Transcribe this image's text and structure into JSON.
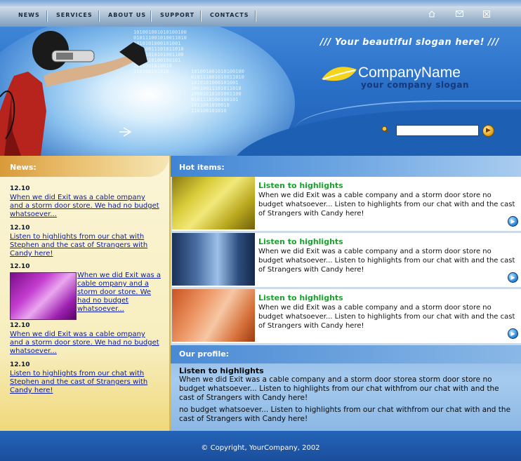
{
  "nav": {
    "items": [
      "NEWS",
      "SERVICES",
      "ABOUT US",
      "SUPPORT",
      "CONTACTS"
    ],
    "icons": [
      "home-icon",
      "mail-icon",
      "sitemap-icon"
    ]
  },
  "header": {
    "slogan": "///  Your beautiful slogan here!  ///",
    "company_name": "CompanyName",
    "company_slogan": "your company slogan",
    "binary_text": "101001001010100100\n010111001010011010\n1010101000101001\n10010011101011010\n10001010101001100\n0101110100100101\n1011001010010\n110100101010"
  },
  "search": {
    "placeholder": ""
  },
  "news": {
    "title": "News:",
    "items": [
      {
        "date": "12.10",
        "text": "When we did Exit was a cable ompany and a storm door store. We had no budget whatsoever..."
      },
      {
        "date": "12.10",
        "text": "Listen to highlights from our chat with Stephen and the cast of Strangers with Candy here!"
      },
      {
        "date": "12.10",
        "text": "When we did Exit was a cable ompany and a storm door store. We had no budget whatsoever..."
      },
      {
        "date": "12.10",
        "text": "When we did Exit was a cable ompany and a storm door store. We had no budget whatsoever..."
      },
      {
        "date": "12.10",
        "text": "Listen to highlights from our chat with Stephen and the cast of Strangers with Candy here!"
      }
    ]
  },
  "hot": {
    "title": "Hot items:",
    "items": [
      {
        "title": "Listen to highlights",
        "text": "When we did Exit was a cable company and a storm door store no budget whatsoever... Listen to highlights from our chat with and the cast of Strangers with Candy here!"
      },
      {
        "title": "Listen to highlights",
        "text": "When we did Exit was a cable company and a storm door store no budget whatsoever... Listen to highlights from our chat with and the cast of Strangers with Candy here!"
      },
      {
        "title": "Listen to highlights",
        "text": "When we did Exit was a cable company and a storm door store no budget whatsoever... Listen to highlights from our chat with and the cast of Strangers with Candy here!"
      }
    ]
  },
  "profile": {
    "title": "Our profile:",
    "heading": "Listen to highlights",
    "para1": "When we did Exit was a cable company and a storm door storea storm door store no budget whatsoever... Listen to highlights from our chat withfrom our chat with and the cast of Strangers with Candy here!",
    "para2": "no budget whatsoever... Listen to highlights from our chat withfrom our chat with and the cast of Strangers with Candy here!"
  },
  "footer": {
    "copyright": "© Copyright, YourCompany, 2002"
  }
}
